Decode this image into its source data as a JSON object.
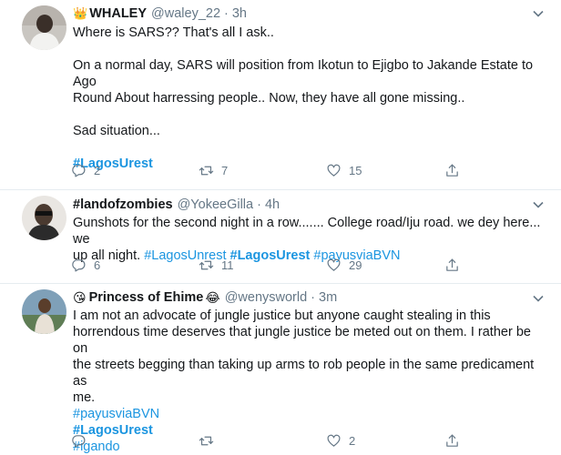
{
  "tweets": [
    {
      "name_emoji": "👑",
      "name": "WHALEY",
      "handle": "@waley_22",
      "time": "3h",
      "line1": "Where is SARS?? That's all I ask..",
      "line2": "On a normal day, SARS will position from Ikotun to Ejigbo to Jakande Estate to Ago",
      "line3": "Round About harressing people.. Now, they have all gone missing..",
      "line4": "Sad situation...",
      "hashtag": "#LagosUrest",
      "replies": "2",
      "retweets": "7",
      "likes": "15"
    },
    {
      "name": "#landofzombies",
      "handle": "@YokeeGilla",
      "time": "4h",
      "line1": "Gunshots for the second night in a row....... College road/Iju road. we dey here... we",
      "line2_text": "up all night.",
      "hashtag1": "#LagosUnrest",
      "hashtag2": "#LagosUrest",
      "hashtag3": "#payusviaBVN",
      "replies": "6",
      "retweets": "11",
      "likes": "29"
    },
    {
      "name_emoji_left": "😘",
      "name": "Princess of Ehime",
      "name_emoji_right": "😂",
      "handle": "@wenysworld",
      "time": "3m",
      "line1": "I am not an advocate of jungle justice but anyone caught stealing in this",
      "line2": "horrendous time deserves that jungle justice be meted out on them. I rather be on",
      "line3": "the streets begging than taking up arms to rob people in the same predicament as",
      "line4": "me.",
      "hashtag1": "#payusviaBVN",
      "hashtag2": "#LagosUrest",
      "hashtag3": "#igando",
      "replies": "",
      "retweets": "",
      "likes": "2"
    }
  ],
  "colors": {
    "link": "#1b95e0",
    "muted": "#657786",
    "divider": "#e6ecf0"
  },
  "icons": [
    "reply-icon",
    "retweet-icon",
    "like-icon",
    "share-icon",
    "caret-down-icon"
  ]
}
